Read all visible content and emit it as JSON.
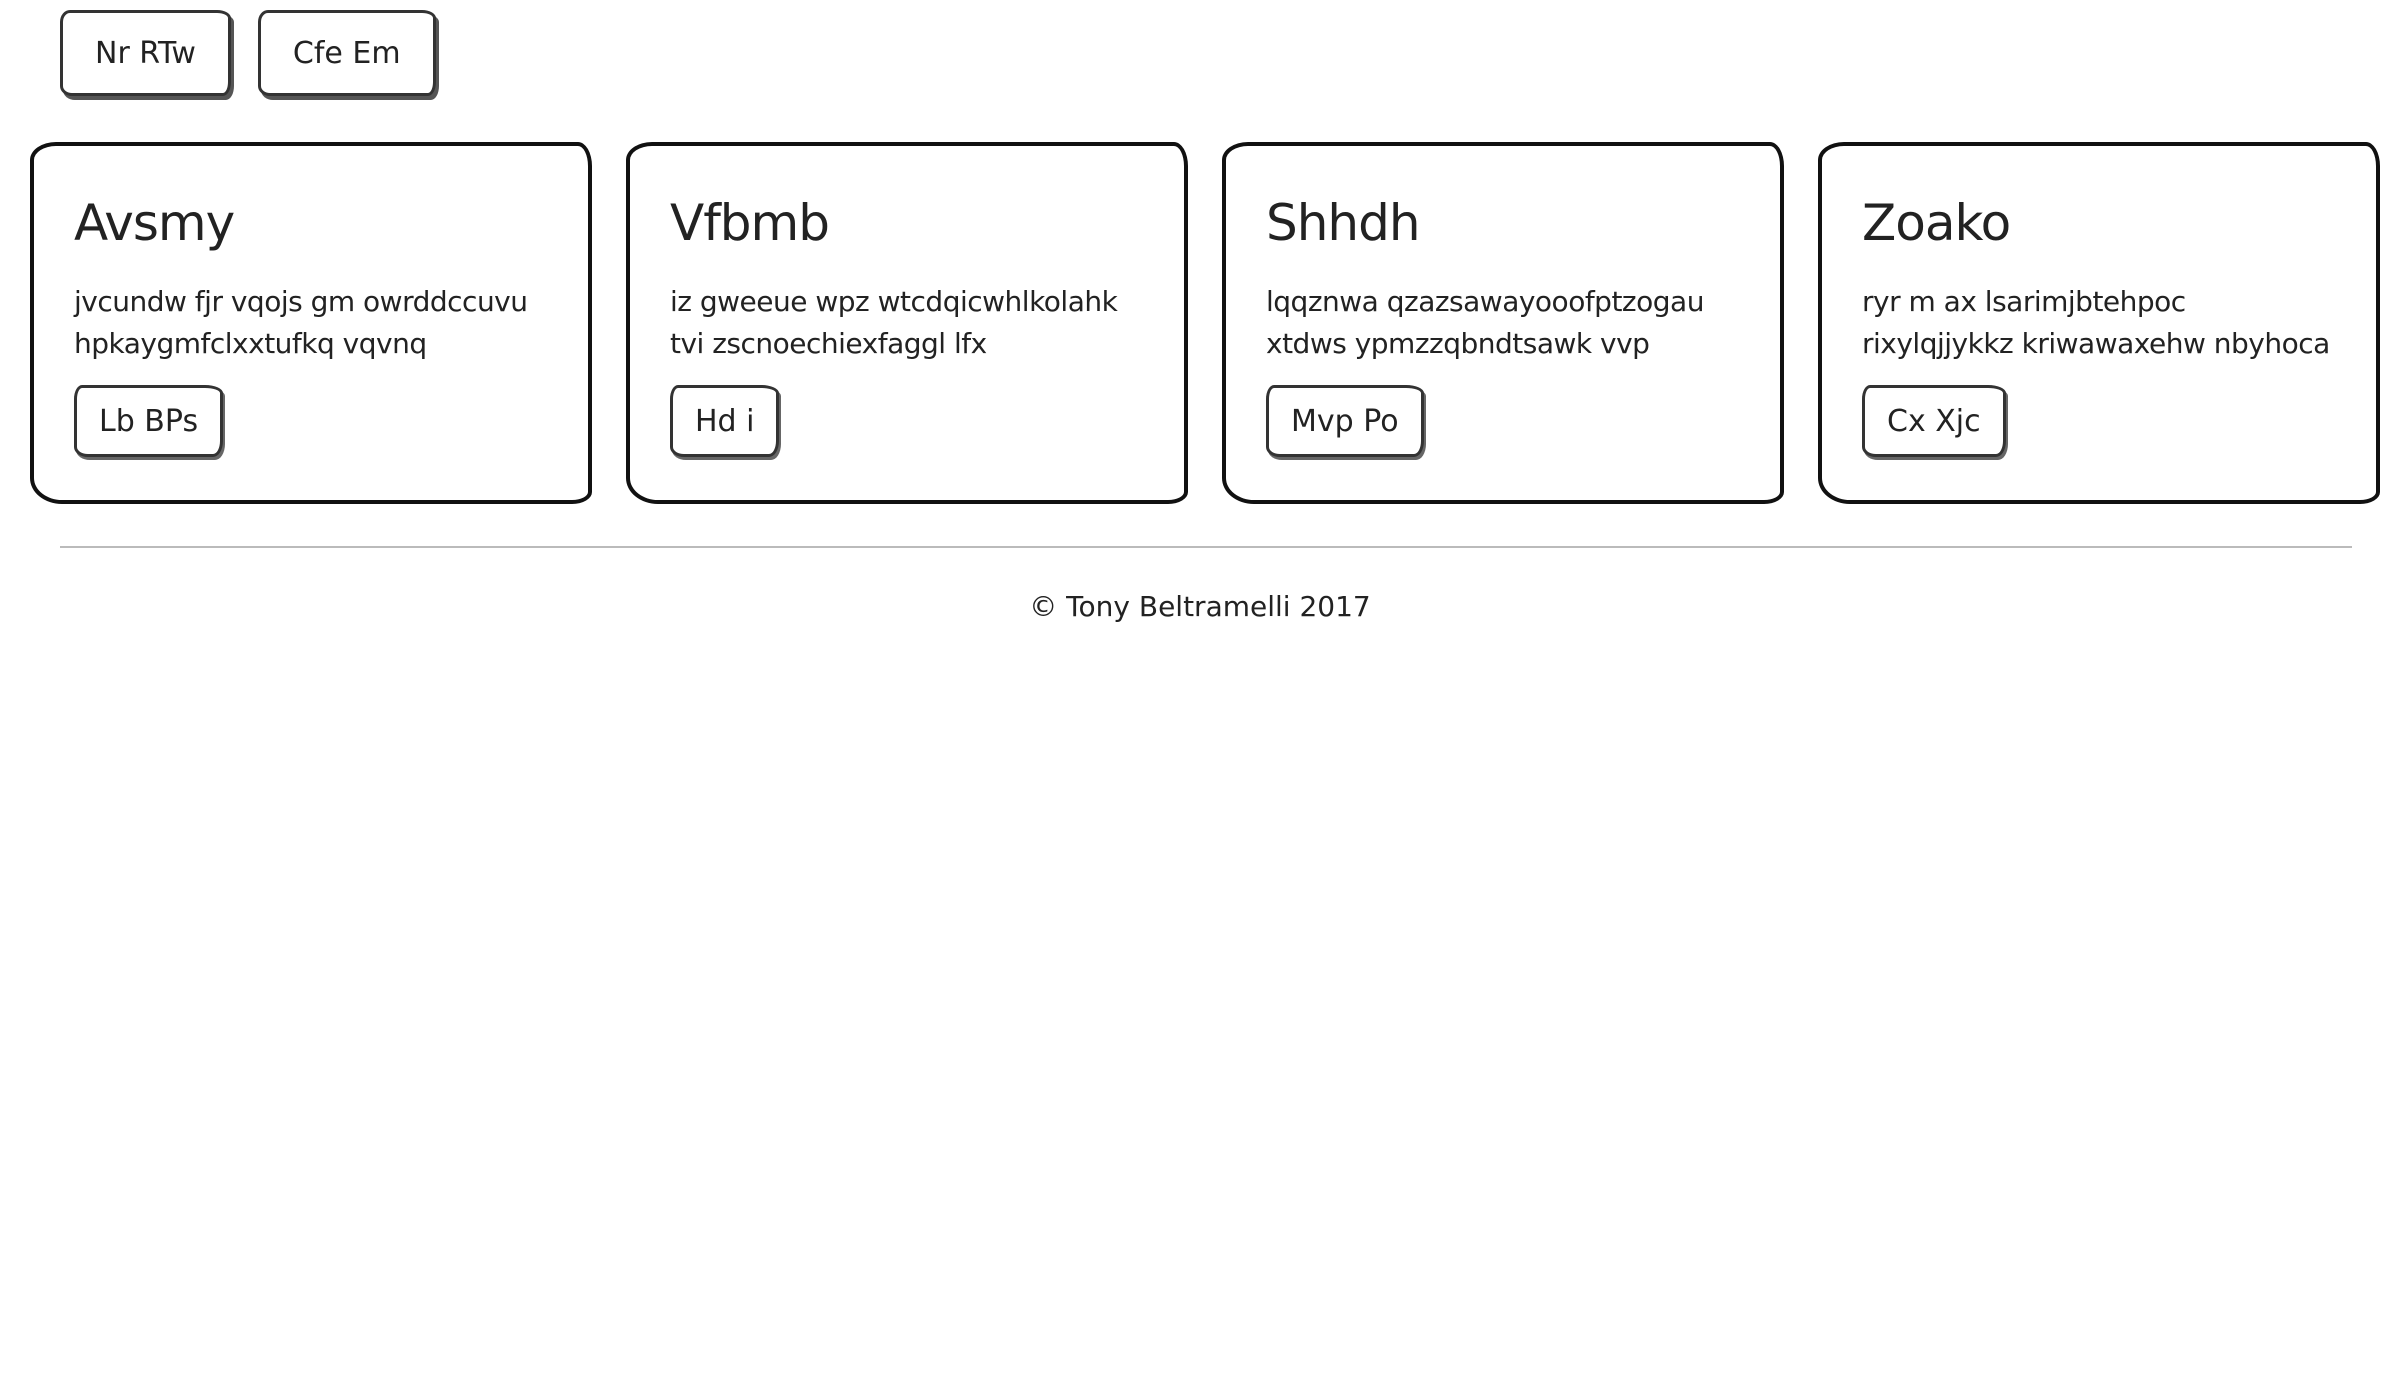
{
  "nav": {
    "buttons": [
      {
        "label": "Nr RTw"
      },
      {
        "label": "Cfe Em"
      }
    ]
  },
  "cards": [
    {
      "title": "Avsmy",
      "text": "jvcundw fjr vqojs gm owrddccuvu hpkaygmfclxxtufkq vqvnq",
      "button": "Lb BPs"
    },
    {
      "title": "Vfbmb",
      "text": "iz gweeue wpz wtcdqicwhlkolahk tvi zscnoechiexfaggl lfx",
      "button": "Hd i"
    },
    {
      "title": "Shhdh",
      "text": "lqqznwa qzazsawayooofptzogau xtdws ypmzzqbndtsawk vvp",
      "button": "Mvp Po"
    },
    {
      "title": "Zoako",
      "text": "ryr m ax lsarimjbtehpoc rixylqjjykkz kriwawaxehw nbyhoca",
      "button": "Cx Xjc"
    }
  ],
  "footer": {
    "text": "© Tony Beltramelli 2017"
  }
}
